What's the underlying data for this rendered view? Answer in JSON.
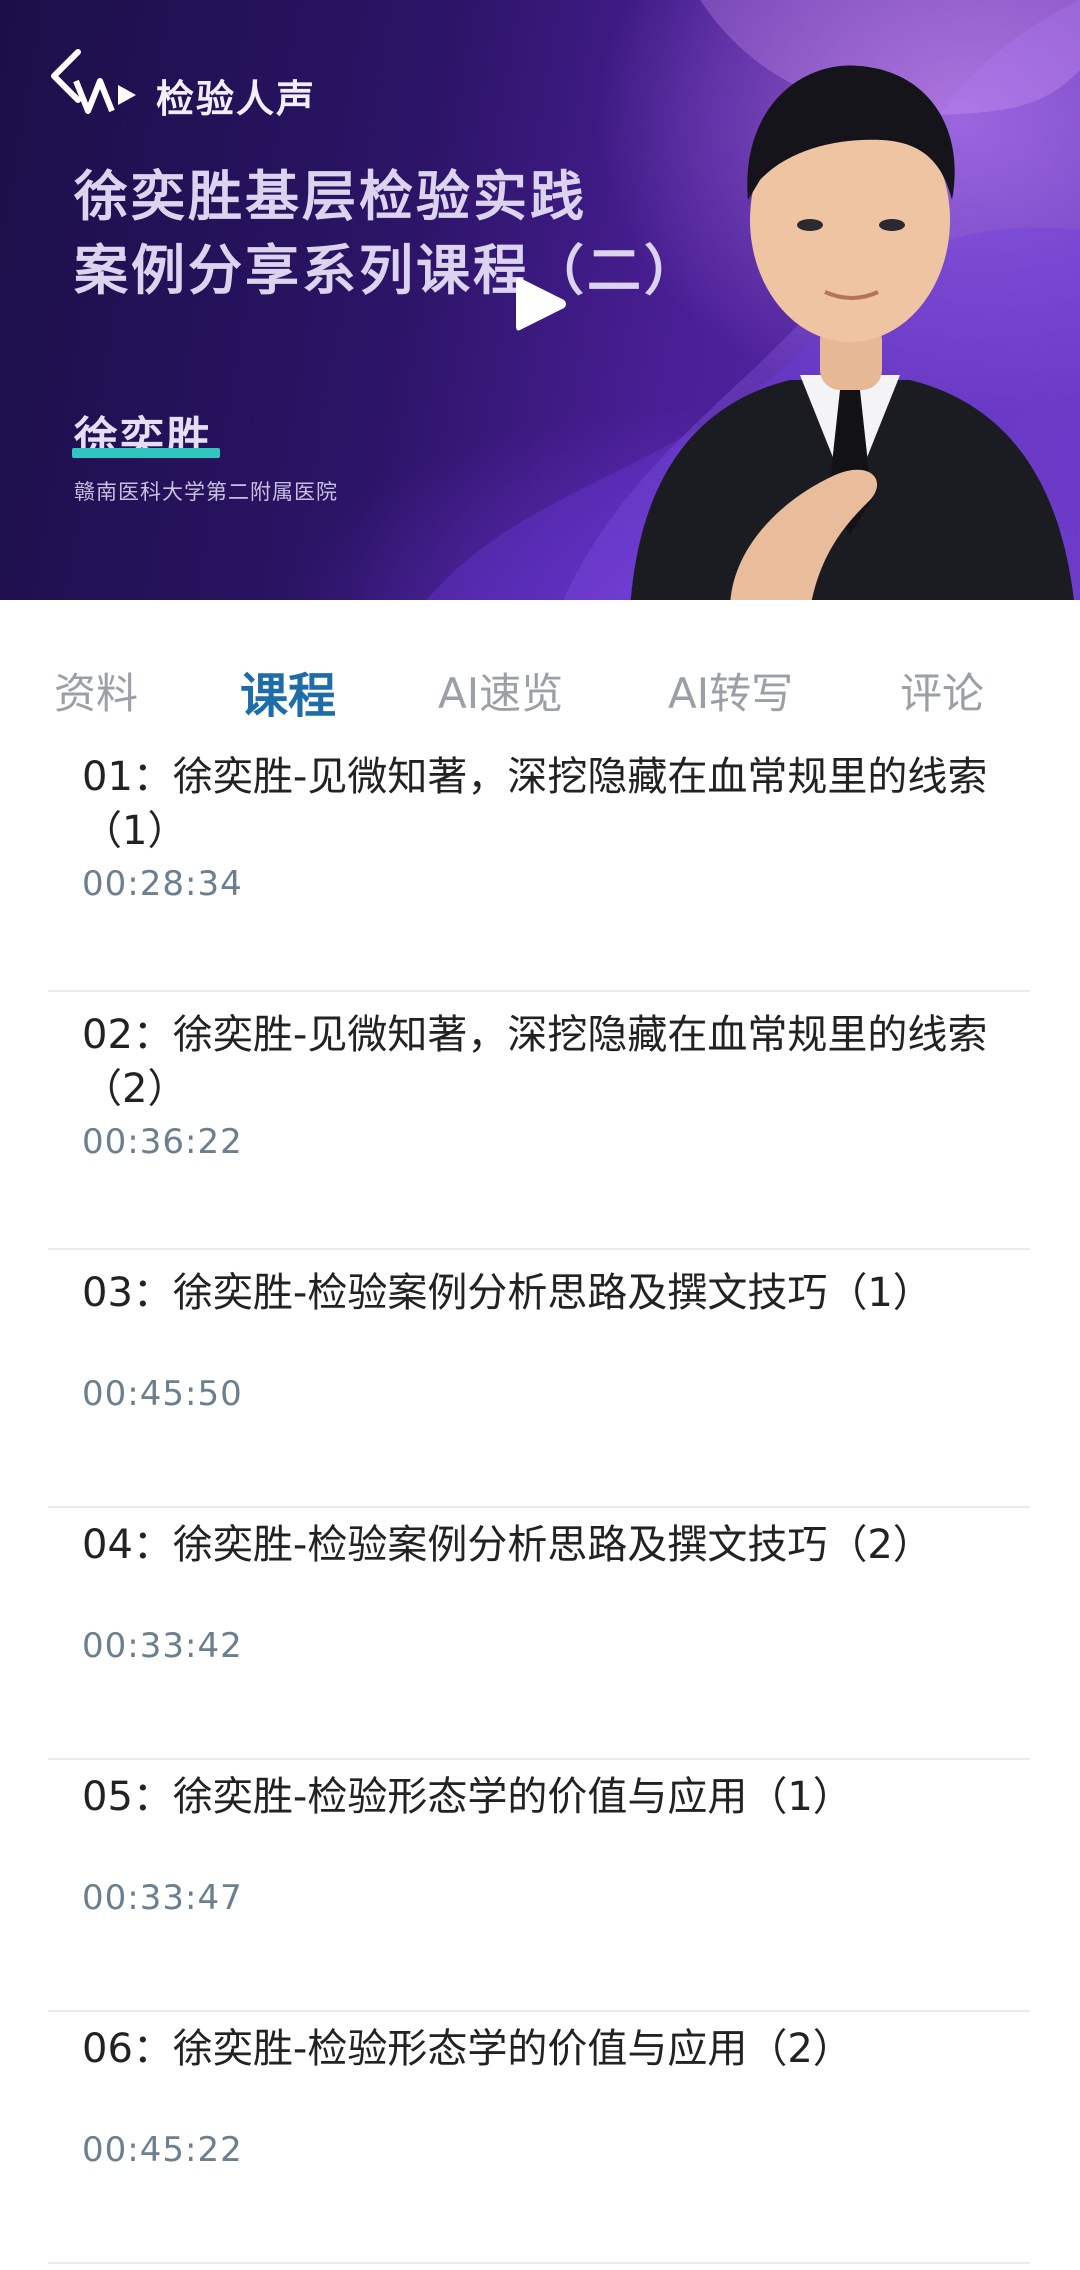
{
  "banner": {
    "logo_text": "检验人声",
    "title_line1": "徐奕胜基层检验实践",
    "title_line2": "案例分享系列课程（二）",
    "speaker": "徐奕胜",
    "hospital": "赣南医科大学第二附属医院",
    "accent_color": "#2fc6c0"
  },
  "tabs": [
    {
      "label": "资料",
      "active": false
    },
    {
      "label": "课程",
      "active": true
    },
    {
      "label": "AI速览",
      "active": false
    },
    {
      "label": "AI转写",
      "active": false
    },
    {
      "label": "评论",
      "active": false
    }
  ],
  "lessons": [
    {
      "title": "01：徐奕胜-见微知著，深挖隐藏在血常规里的线索（1）",
      "duration": "00:28:34"
    },
    {
      "title": "02：徐奕胜-见微知著，深挖隐藏在血常规里的线索（2）",
      "duration": "00:36:22"
    },
    {
      "title": "03：徐奕胜-检验案例分析思路及撰文技巧（1）",
      "duration": "00:45:50"
    },
    {
      "title": "04：徐奕胜-检验案例分析思路及撰文技巧（2）",
      "duration": "00:33:42"
    },
    {
      "title": "05：徐奕胜-检验形态学的价值与应用（1）",
      "duration": "00:33:47"
    },
    {
      "title": "06：徐奕胜-检验形态学的价值与应用（2）",
      "duration": "00:45:22"
    }
  ],
  "icons": {
    "back": "chevron-left-icon",
    "play": "play-icon",
    "logo": "sound-wave-logo-icon"
  },
  "colors": {
    "active_tab": "#1f6cab",
    "inactive_tab": "#9aa0a6",
    "duration_text": "#6b7f8e"
  }
}
